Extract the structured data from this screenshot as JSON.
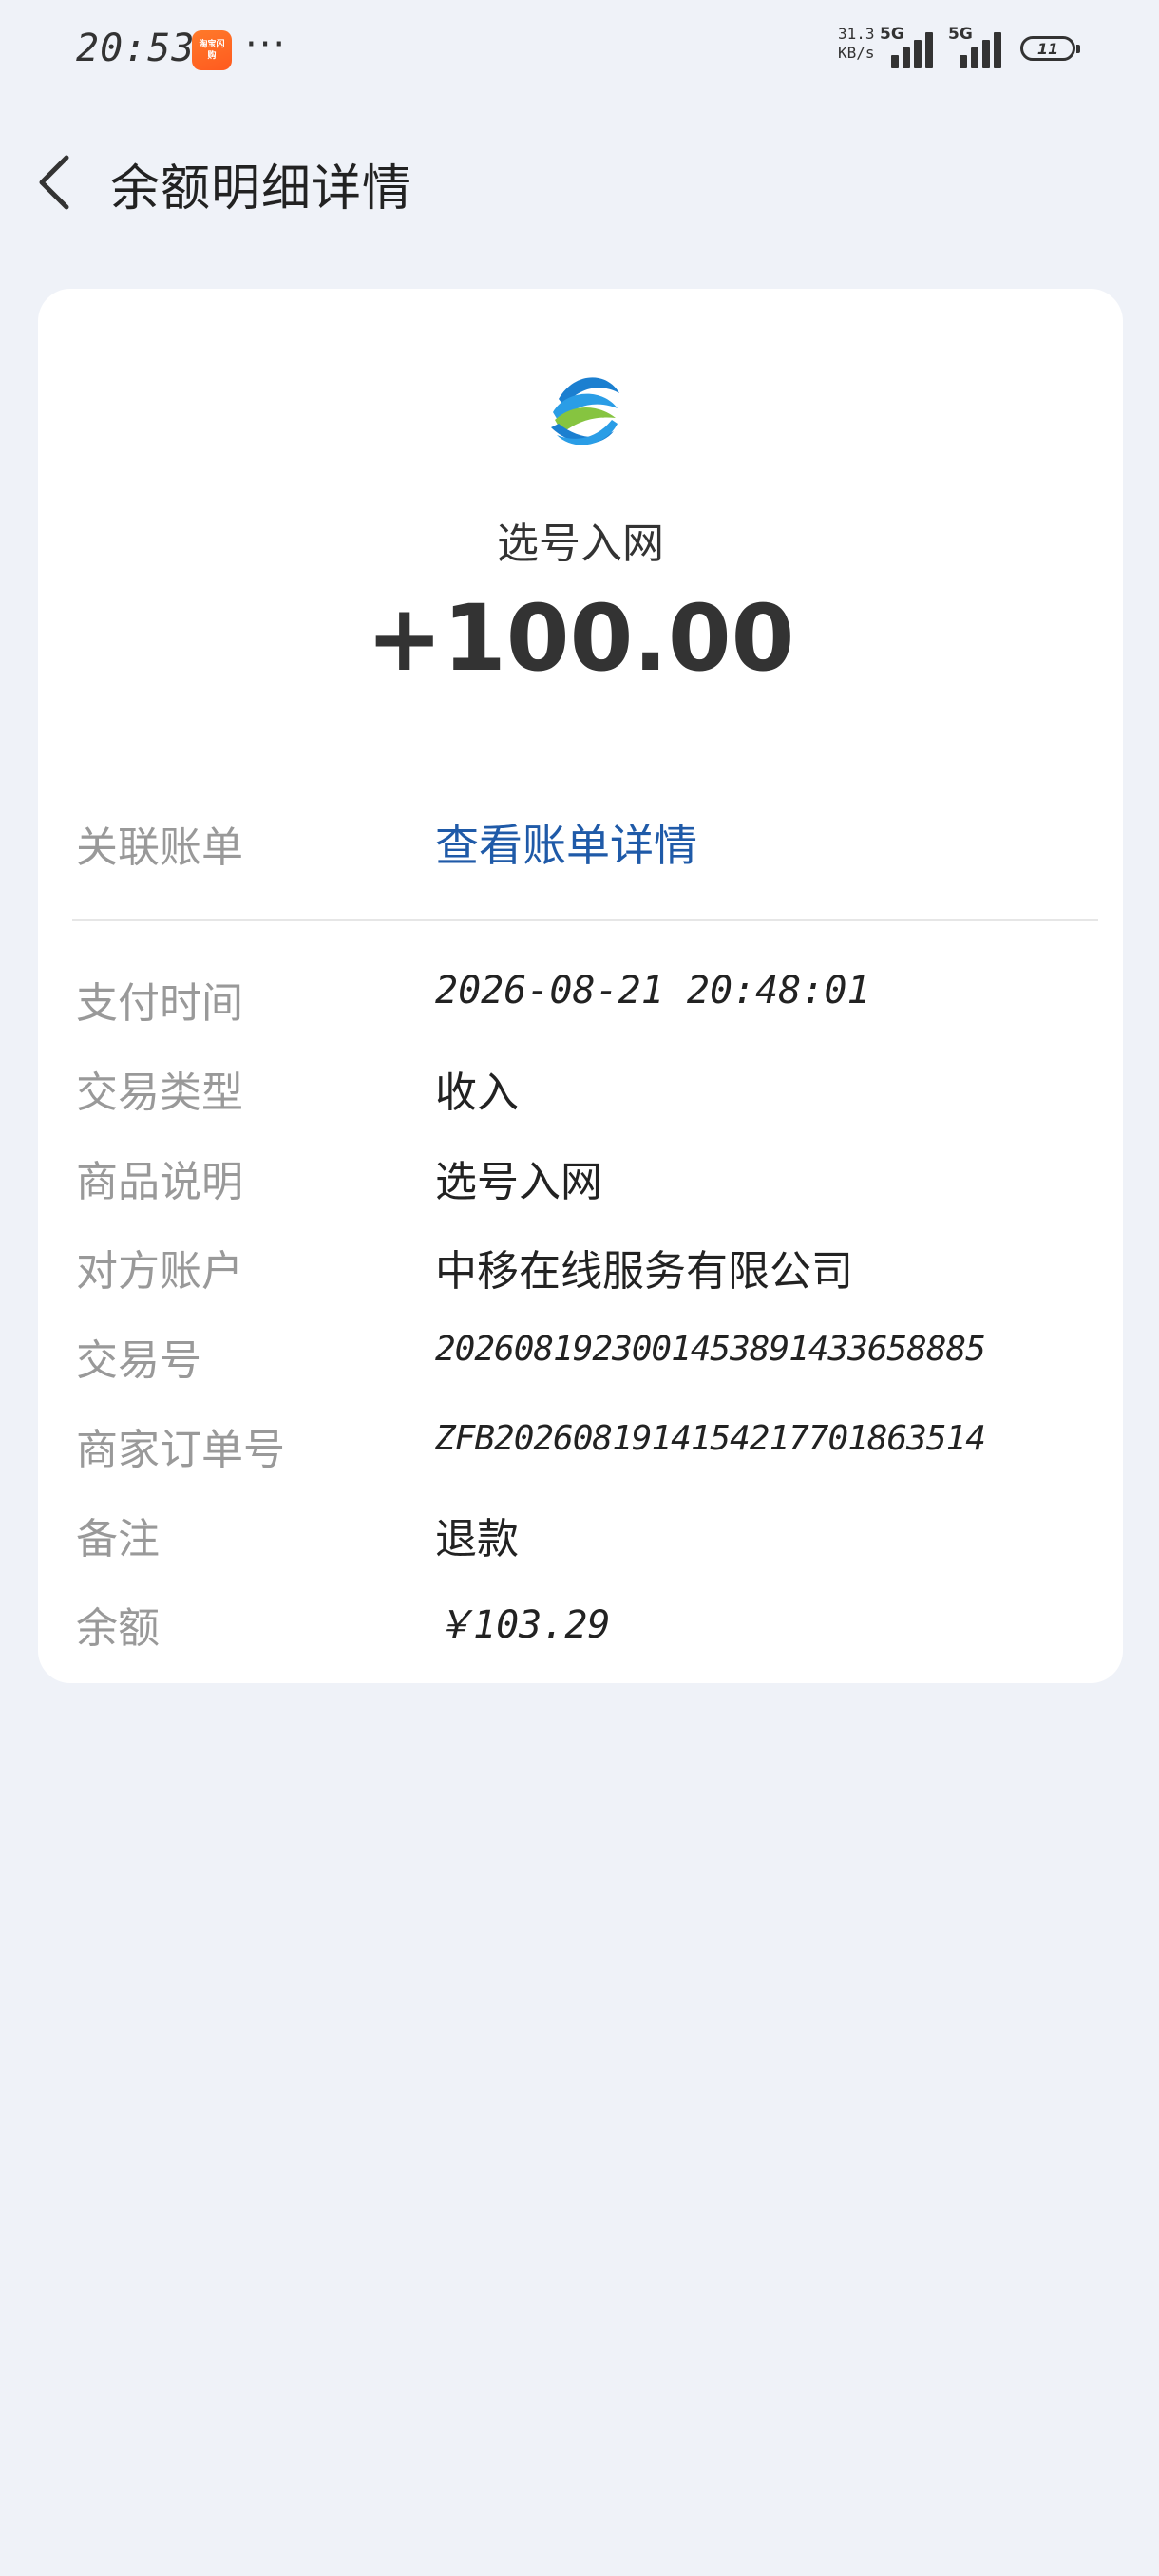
{
  "status_bar": {
    "time": "20:53",
    "app_icon_text": "淘宝闪购",
    "more": "···",
    "net_speed_value": "31.3",
    "net_speed_unit": "KB/s",
    "network_1": "5G",
    "network_2": "5G",
    "battery": "11"
  },
  "header": {
    "back_icon": "chevron-left-icon",
    "title": "余额明细详情"
  },
  "card": {
    "logo_icon": "china-mobile-logo-icon",
    "merchant_name": "选号入网",
    "amount": "+100.00",
    "related_bill": {
      "label": "关联账单",
      "value": "查看账单详情"
    },
    "details": [
      {
        "label": "支付时间",
        "value": "2026-08-21 20:48:01"
      },
      {
        "label": "交易类型",
        "value": "收入"
      },
      {
        "label": "商品说明",
        "value": "选号入网"
      },
      {
        "label": "对方账户",
        "value": "中移在线服务有限公司"
      },
      {
        "label": "交易号",
        "value": "2026081923001453891433658885"
      },
      {
        "label": "商家订单号",
        "value": "ZFB2026081914154217701863514"
      },
      {
        "label": "备注",
        "value": "退款"
      },
      {
        "label": "余额",
        "value": "￥103.29"
      }
    ]
  },
  "colors": {
    "background": "#eff2f8",
    "card": "#ffffff",
    "link": "#1f5aa8",
    "label": "#999999"
  }
}
